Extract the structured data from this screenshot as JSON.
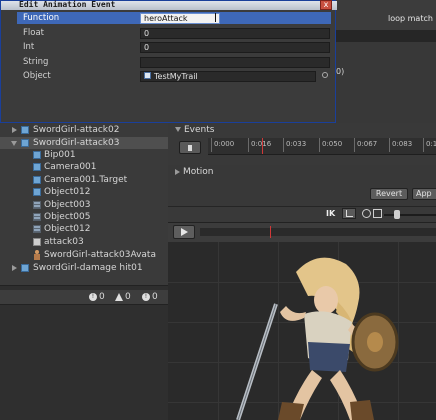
{
  "dialog": {
    "title": "Edit Animation Event",
    "close_glyph": "x",
    "fields": [
      {
        "label": "Function",
        "value": "heroAttack"
      },
      {
        "label": "Float",
        "value": "0"
      },
      {
        "label": "Int",
        "value": "0"
      },
      {
        "label": "String",
        "value": ""
      },
      {
        "label": "Object",
        "value": "TestMyTrail"
      }
    ]
  },
  "hierarchy": {
    "items": [
      {
        "label": "SwordGirl-attack02"
      },
      {
        "label": "SwordGirl-attack03"
      },
      {
        "label": "Bip001"
      },
      {
        "label": "Camera001"
      },
      {
        "label": "Camera001.Target"
      },
      {
        "label": "Object012"
      },
      {
        "label": "Object003"
      },
      {
        "label": "Object005"
      },
      {
        "label": "Object012"
      },
      {
        "label": "attack03"
      },
      {
        "label": "SwordGirl-attack03Avata"
      },
      {
        "label": "SwordGirl-damage hit01"
      }
    ]
  },
  "console": {
    "info_count": "0",
    "warning_count": "0",
    "error_count": "0"
  },
  "animation": {
    "loop_match_label": "loop match",
    "property_suffix": "0)",
    "events_label": "Events",
    "motion_label": "Motion",
    "revert_label": "Revert",
    "apply_label": "App",
    "ik_label": "IK",
    "ruler_ticks": [
      "0:000",
      "0:016",
      "0:033",
      "0:050",
      "0:067",
      "0:083",
      "0:1"
    ]
  },
  "colors": {
    "dialog_border": "#1a3f9a",
    "selection": "#3e68b8",
    "playhead": "#d03838"
  }
}
